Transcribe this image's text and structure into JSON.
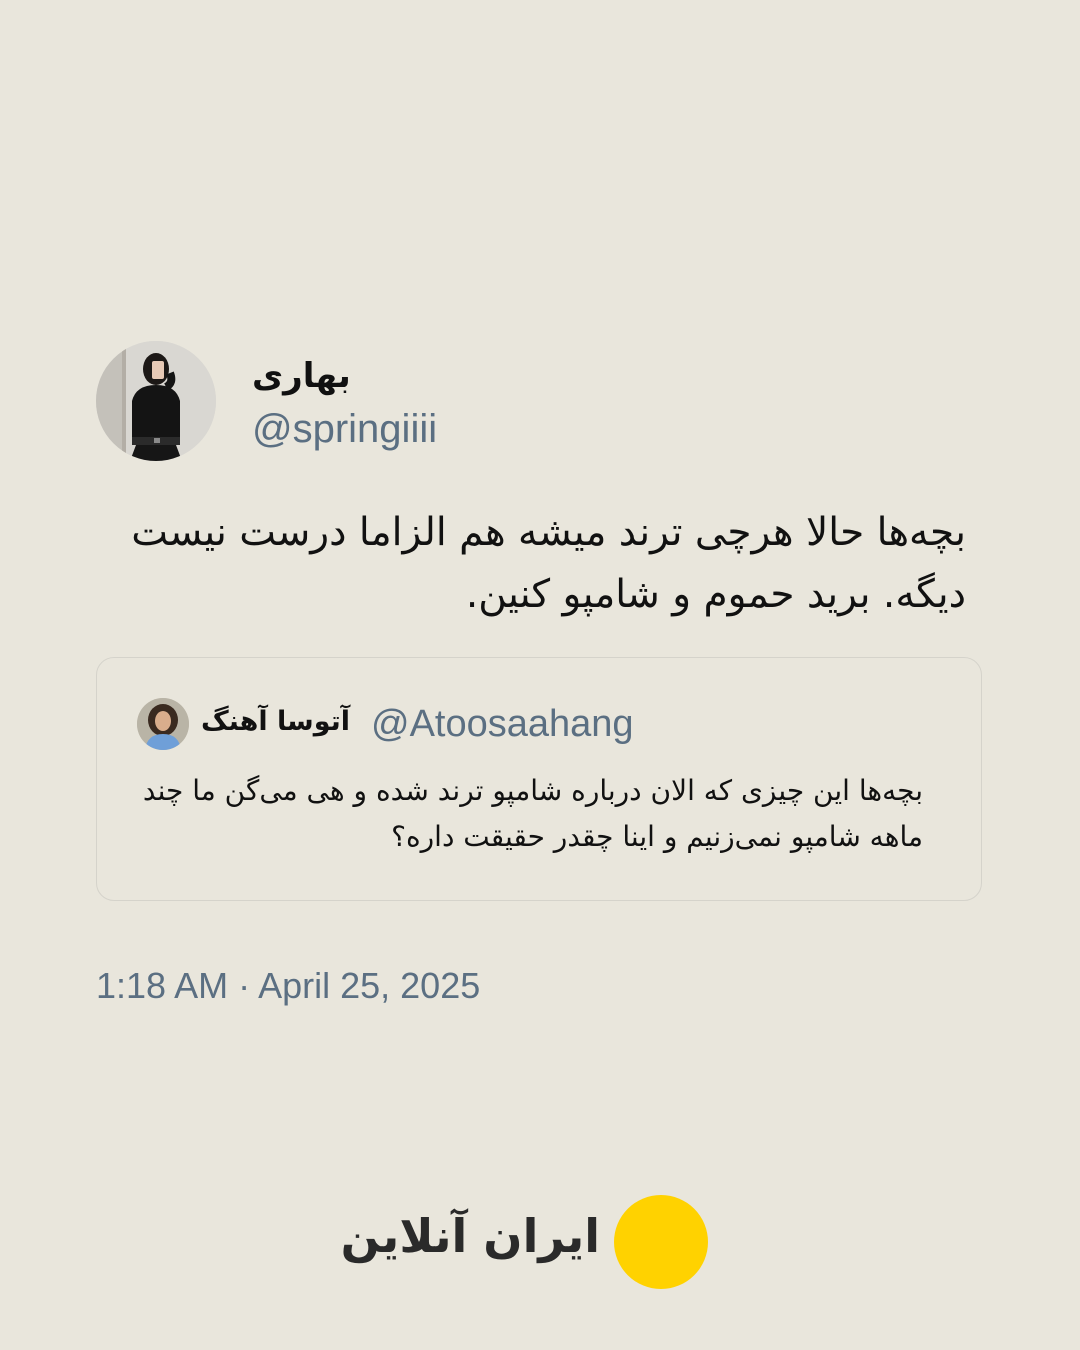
{
  "author": {
    "display_name": "بهاری",
    "handle": "@springiiii"
  },
  "tweet": {
    "text": "بچه‌ها حالا هرچی ترند میشه هم الزاما درست نیست دیگه. برید حموم و شامپو کنین."
  },
  "quoted_tweet": {
    "display_name": "آتوسا آهنگ",
    "handle": "@Atoosaahang",
    "text": "بچه‌ها این چیزی که الان درباره شامپو ترند شده و هی می‌گن ما چند ماهه شامپو نمی‌زنیم و اینا چقدر حقیقت داره؟"
  },
  "timestamp": "1:18 AM · April 25, 2025",
  "brand": {
    "name": "ایران آنلاین",
    "accent_color": "#ffd200"
  },
  "colors": {
    "background": "#e9e6dc",
    "secondary_text": "#5b6f82",
    "primary_text": "#111111"
  }
}
